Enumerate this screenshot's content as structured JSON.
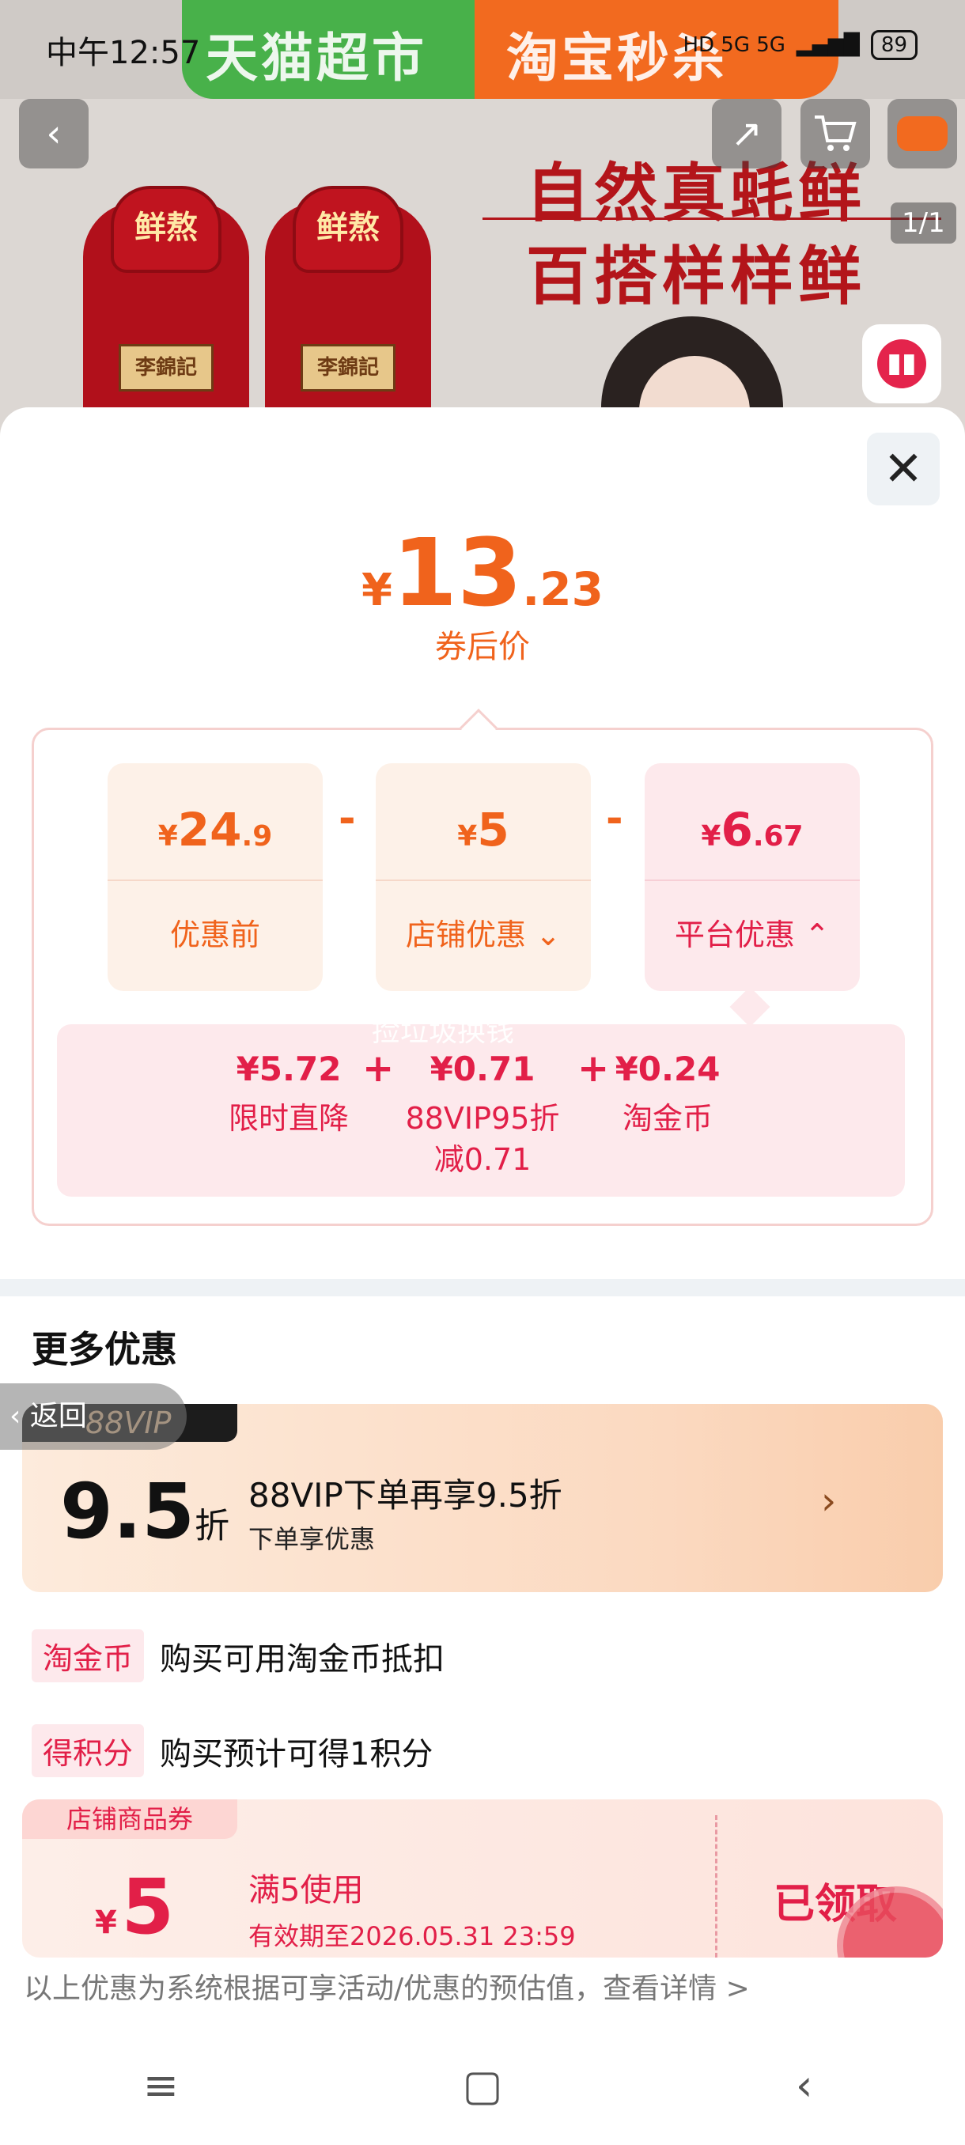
{
  "status_bar": {
    "time": "中午12:57",
    "network": "HD 5G 5G",
    "battery": "89"
  },
  "product_bg": {
    "banner_left": "天猫超市",
    "banner_right": "淘宝秒杀",
    "bottle_cap": "鲜熬",
    "bottle_brand": "李錦記",
    "slogan_line1": "自然真蚝鲜",
    "slogan_line2": "百搭样样鲜",
    "page_indicator": "1/1"
  },
  "sheet": {
    "final_price": {
      "currency": "¥",
      "integer": "13",
      "decimal": ".23",
      "label": "券后价"
    },
    "breakdown": [
      {
        "currency": "¥",
        "integer": "24",
        "decimal": ".9",
        "label": "优惠前",
        "chevron": ""
      },
      {
        "currency": "¥",
        "integer": "5",
        "decimal": "",
        "label": "店铺优惠",
        "chevron": "⌄"
      },
      {
        "currency": "¥",
        "integer": "6",
        "decimal": ".67",
        "label": "平台优惠",
        "chevron": "⌃"
      }
    ],
    "operator": "-",
    "platform_details": [
      {
        "amount": "¥5.72",
        "label": "限时直降"
      },
      {
        "amount": "¥0.71",
        "label": "88VIP95折\n减0.71"
      },
      {
        "amount": "¥0.24",
        "label": "淘金币"
      }
    ],
    "plus": "+",
    "watermark": "捡垃圾换钱",
    "more_title": "更多优惠",
    "vip": {
      "tag": "88VIP",
      "rate_number": "9.5",
      "rate_unit": "折",
      "title": "88VIP下单再享9.5折",
      "subtitle": "下单享优惠",
      "chevron": "›"
    },
    "back_label": "返回",
    "perks": [
      {
        "tag": "淘金币",
        "text": "购买可用淘金币抵扣"
      },
      {
        "tag": "得积分",
        "text": "购买预计可得1积分"
      }
    ],
    "coupon": {
      "tag": "店铺商品券",
      "currency": "¥",
      "amount": "5",
      "condition": "满5使用",
      "expiry": "有效期至2026.05.31 23:59",
      "status": "已领取"
    },
    "disclaimer": "以上优惠为系统根据可享活动/优惠的预估值，查看详情 >"
  },
  "nav": {
    "menu": "≡",
    "home": "▢",
    "back": "‹"
  }
}
